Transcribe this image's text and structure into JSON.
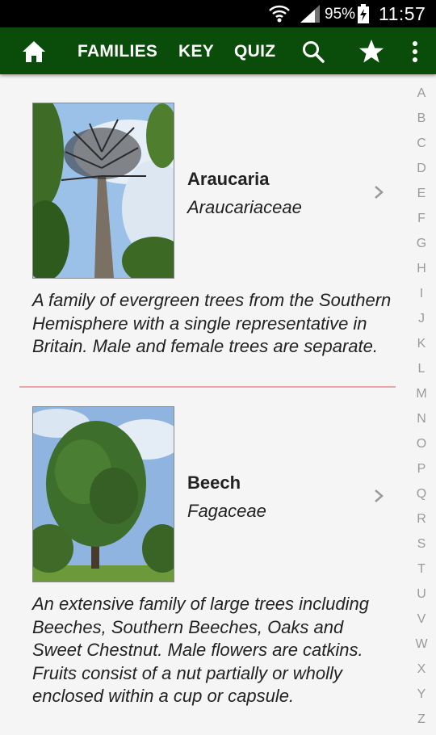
{
  "status_bar": {
    "battery_percent": "95%",
    "time": "11:57",
    "icons": [
      "wifi-icon",
      "signal-icon",
      "battery-charging-icon"
    ]
  },
  "app_bar": {
    "home_icon": "home-icon",
    "nav": [
      "FAMILIES",
      "KEY",
      "QUIZ"
    ],
    "search_icon": "search-icon",
    "favorite_icon": "star-icon",
    "more_icon": "more-vertical-icon",
    "color": "#0a4d0a"
  },
  "entries": [
    {
      "name": "Araucaria",
      "family": "Araucariaceae",
      "description": "A family of evergreen trees from the Southern Hemisphere with a single representative in Britain. Male and female trees are separate."
    },
    {
      "name": "Beech",
      "family": "Fagaceae",
      "description": "An extensive family of large trees including Beeches, Southern Beeches, Oaks and Sweet Chestnut. Male flowers are catkins. Fruits consist of a nut partially or wholly enclosed within a cup or capsule."
    }
  ],
  "alphabet_index": [
    "A",
    "B",
    "C",
    "D",
    "E",
    "F",
    "G",
    "H",
    "I",
    "J",
    "K",
    "L",
    "M",
    "N",
    "O",
    "P",
    "Q",
    "R",
    "S",
    "T",
    "U",
    "V",
    "W",
    "X",
    "Y",
    "Z"
  ],
  "divider_color": "#f0a3a3"
}
